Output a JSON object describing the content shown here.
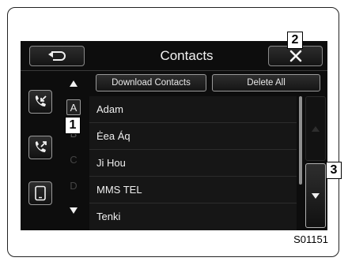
{
  "header": {
    "title": "Contacts"
  },
  "actions": {
    "download_label": "Download Contacts",
    "delete_label": "Delete All"
  },
  "index": {
    "letters": [
      "A",
      "B",
      "C",
      "D"
    ]
  },
  "contacts": [
    "Adam",
    "Ėea Áq",
    "Ji Hou",
    "MMS TEL",
    "Tenki"
  ],
  "callouts": [
    "1",
    "2",
    "3"
  ],
  "figure_code": "S01151",
  "colors": {
    "screen_bg": "#0d0d0d",
    "row_bg": "#161616",
    "button_border": "#9a9a9a",
    "text": "#f0f0f0"
  },
  "icons": {
    "back": "back-arrow-icon",
    "close": "close-x-icon",
    "recent_incoming": "incoming-call-icon",
    "recent_outgoing": "outgoing-call-icon",
    "phonebook": "phone-device-icon",
    "scroll_up": "triangle-up-icon",
    "scroll_down": "triangle-down-icon"
  }
}
